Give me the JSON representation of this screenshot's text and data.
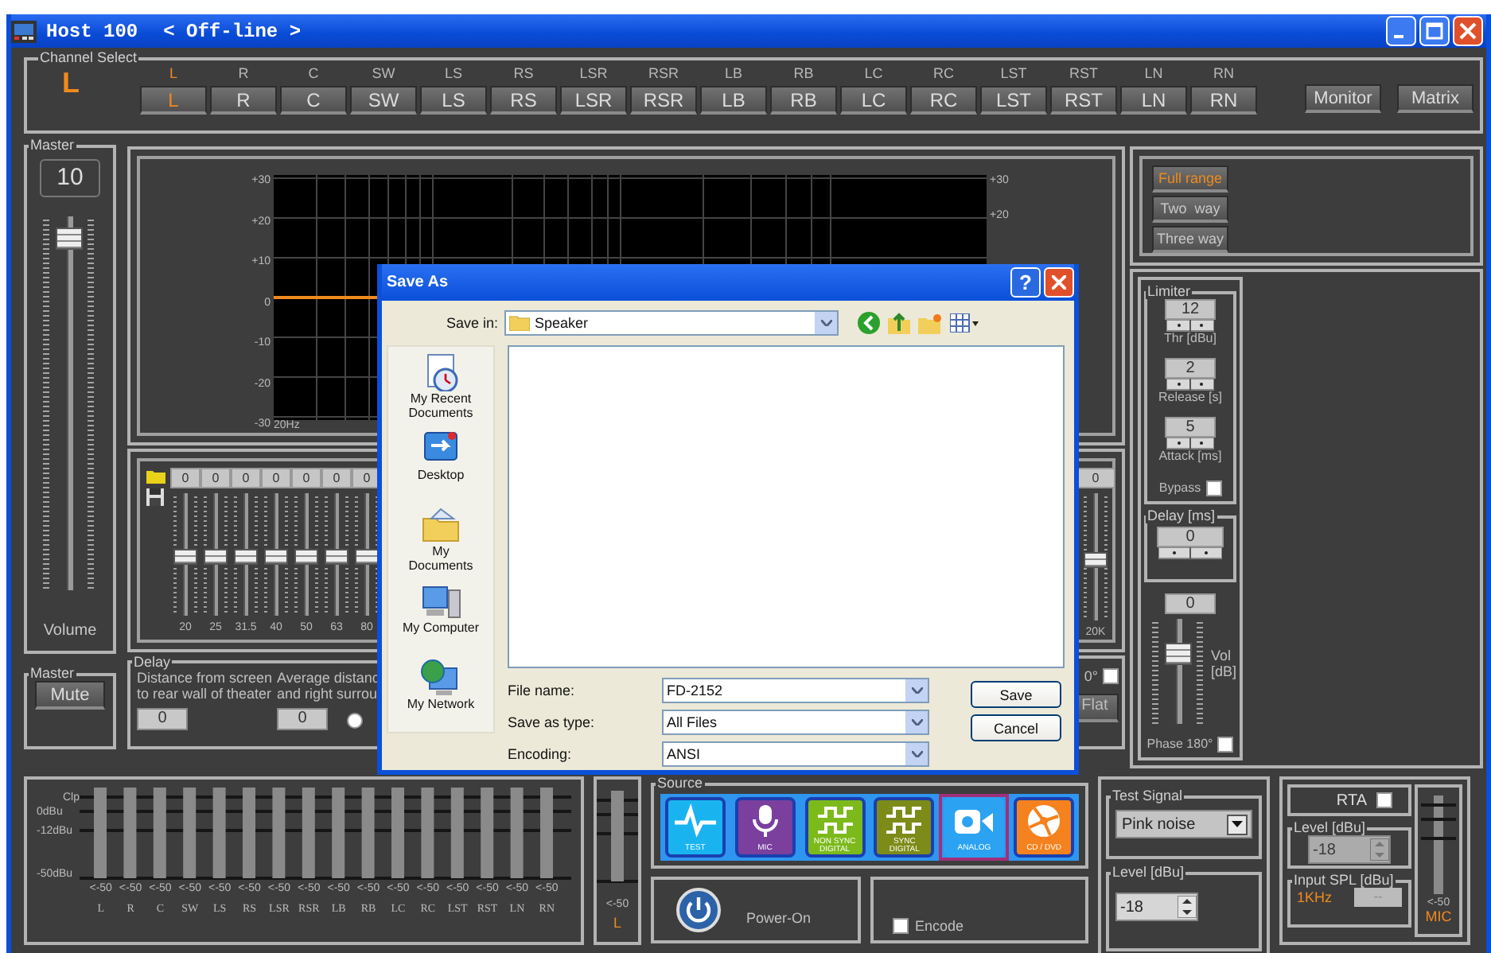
{
  "window": {
    "title": "Host 100",
    "status": "< Off-line >"
  },
  "channel_select": {
    "title": "Channel Select",
    "current": "L",
    "channels": [
      {
        "label": "L",
        "button": "L",
        "selected": true
      },
      {
        "label": "R",
        "button": "R",
        "selected": false
      },
      {
        "label": "C",
        "button": "C",
        "selected": false
      },
      {
        "label": "SW",
        "button": "SW",
        "selected": false
      },
      {
        "label": "LS",
        "button": "LS",
        "selected": false
      },
      {
        "label": "RS",
        "button": "RS",
        "selected": false
      },
      {
        "label": "LSR",
        "button": "LSR",
        "selected": false
      },
      {
        "label": "RSR",
        "button": "RSR",
        "selected": false
      },
      {
        "label": "LB",
        "button": "LB",
        "selected": false
      },
      {
        "label": "RB",
        "button": "RB",
        "selected": false
      },
      {
        "label": "LC",
        "button": "LC",
        "selected": false
      },
      {
        "label": "RC",
        "button": "RC",
        "selected": false
      },
      {
        "label": "LST",
        "button": "LST",
        "selected": false
      },
      {
        "label": "RST",
        "button": "RST",
        "selected": false
      },
      {
        "label": "LN",
        "button": "LN",
        "selected": false
      },
      {
        "label": "RN",
        "button": "RN",
        "selected": false
      }
    ],
    "buttons": [
      "Monitor",
      "Matrix"
    ]
  },
  "master": {
    "title": "Master",
    "value": "10",
    "level": 0.97,
    "label": "Volume"
  },
  "response_graph": {
    "left_ticks": [
      "+30",
      "+20",
      "+10",
      "0",
      "-10",
      "-20",
      "-30"
    ],
    "right_ticks": [
      "+30",
      "+20"
    ],
    "x_label": "20Hz"
  },
  "crossover": [
    {
      "label": "Full range",
      "selected": true
    },
    {
      "label": "Two  way",
      "selected": false
    },
    {
      "label": "Three way",
      "selected": false
    }
  ],
  "eq": {
    "bands": [
      {
        "value": "0",
        "freq": "20",
        "level": 0.5
      },
      {
        "value": "0",
        "freq": "25",
        "level": 0.5
      },
      {
        "value": "0",
        "freq": "31.5",
        "level": 0.5
      },
      {
        "value": "0",
        "freq": "40",
        "level": 0.5
      },
      {
        "value": "0",
        "freq": "50",
        "level": 0.5
      },
      {
        "value": "0",
        "freq": "63",
        "level": 0.5
      },
      {
        "value": "0",
        "freq": "80",
        "level": 0.5
      }
    ],
    "last_band": {
      "value": "0",
      "freq": "20K",
      "level": 0.5
    }
  },
  "limiter": {
    "title": "Limiter",
    "fields": [
      {
        "value": "12",
        "label": "Thr [dBu]"
      },
      {
        "value": "2",
        "label": "Release [s]"
      },
      {
        "value": "5",
        "label": "Attack [ms]"
      }
    ],
    "bypass": {
      "label": "Bypass",
      "checked": false
    }
  },
  "delay_ms": {
    "title": "Delay [ms]",
    "value": "0"
  },
  "channel_volume": {
    "value": "0",
    "level": 0.72,
    "label": "Vol [dB]",
    "phase": {
      "label": "Phase 180°",
      "checked": false
    }
  },
  "master_mute": {
    "title": "Master",
    "button": "Mute"
  },
  "delay": {
    "title": "Delay",
    "radio_selected": false,
    "items": [
      {
        "lines": [
          "Distance from screen",
          "to rear wall of theater"
        ],
        "value": "0"
      },
      {
        "lines": [
          "Average distanc",
          "and right surrou"
        ],
        "value": "0"
      }
    ]
  },
  "eq_options": {
    "phase_label": "0°",
    "checked": false,
    "flat": "Flat"
  },
  "meters": {
    "scale": [
      "Clp",
      "0dBu",
      "-12dBu",
      "-50dBu"
    ],
    "channels": [
      {
        "reading": "<-50",
        "label": "L"
      },
      {
        "reading": "<-50",
        "label": "R"
      },
      {
        "reading": "<-50",
        "label": "C"
      },
      {
        "reading": "<-50",
        "label": "SW"
      },
      {
        "reading": "<-50",
        "label": "LS"
      },
      {
        "reading": "<-50",
        "label": "RS"
      },
      {
        "reading": "<-50",
        "label": "LSR"
      },
      {
        "reading": "<-50",
        "label": "RSR"
      },
      {
        "reading": "<-50",
        "label": "LB"
      },
      {
        "reading": "<-50",
        "label": "RB"
      },
      {
        "reading": "<-50",
        "label": "LC"
      },
      {
        "reading": "<-50",
        "label": "RC"
      },
      {
        "reading": "<-50",
        "label": "LST"
      },
      {
        "reading": "<-50",
        "label": "RST"
      },
      {
        "reading": "<-50",
        "label": "LN"
      },
      {
        "reading": "<-50",
        "label": "RN"
      }
    ]
  },
  "selected_meter": {
    "reading": "<-50",
    "label": "L"
  },
  "source": {
    "title": "Source",
    "items": [
      {
        "kind": "test",
        "label": "TEST",
        "color": "#19b4f0",
        "selected": false
      },
      {
        "kind": "mic",
        "label": "MIC",
        "color": "#7b3f9e",
        "selected": false
      },
      {
        "kind": "nonsync",
        "label": "NON SYNC DIGITAL",
        "color": "#7cba1c",
        "selected": false
      },
      {
        "kind": "sync",
        "label": "SYNC DIGITAL",
        "color": "#7d8c18",
        "selected": false
      },
      {
        "kind": "analog",
        "label": "ANALOG",
        "color": "#2ba3f2",
        "selected": true
      },
      {
        "kind": "cd",
        "label": "CD / DVD",
        "color": "#f5821e",
        "selected": false
      }
    ]
  },
  "power": {
    "label": "Power-On"
  },
  "encode": {
    "label": "Encode",
    "checked": false
  },
  "test_signal": {
    "title": "Test Signal",
    "value": "Pink noise",
    "level_title": "Level [dBu]",
    "level_value": "-18"
  },
  "rta": {
    "label": "RTA",
    "checked": false,
    "level_title": "Level [dBu]",
    "level_value": "-18",
    "level_disabled": true,
    "spl_title": "Input SPL [dBu]",
    "freq": "1KHz",
    "spl_value": "--"
  },
  "mic_meter": {
    "reading": "<-50",
    "label": "MIC"
  },
  "dialog": {
    "title": "Save As",
    "help": "?",
    "save_in_label": "Save in:",
    "save_in": "Speaker",
    "places": [
      {
        "kind": "recent",
        "label": "My Recent Documents"
      },
      {
        "kind": "desktop",
        "label": "Desktop"
      },
      {
        "kind": "documents",
        "label": "My Documents"
      },
      {
        "kind": "computer",
        "label": "My Computer"
      },
      {
        "kind": "network",
        "label": "My Network"
      }
    ],
    "fields": [
      {
        "label": "File name:",
        "value": "FD-2152"
      },
      {
        "label": "Save as type:",
        "value": "All Files"
      },
      {
        "label": "Encoding:",
        "value": "ANSI"
      }
    ],
    "buttons": [
      "Save",
      "Cancel"
    ]
  }
}
